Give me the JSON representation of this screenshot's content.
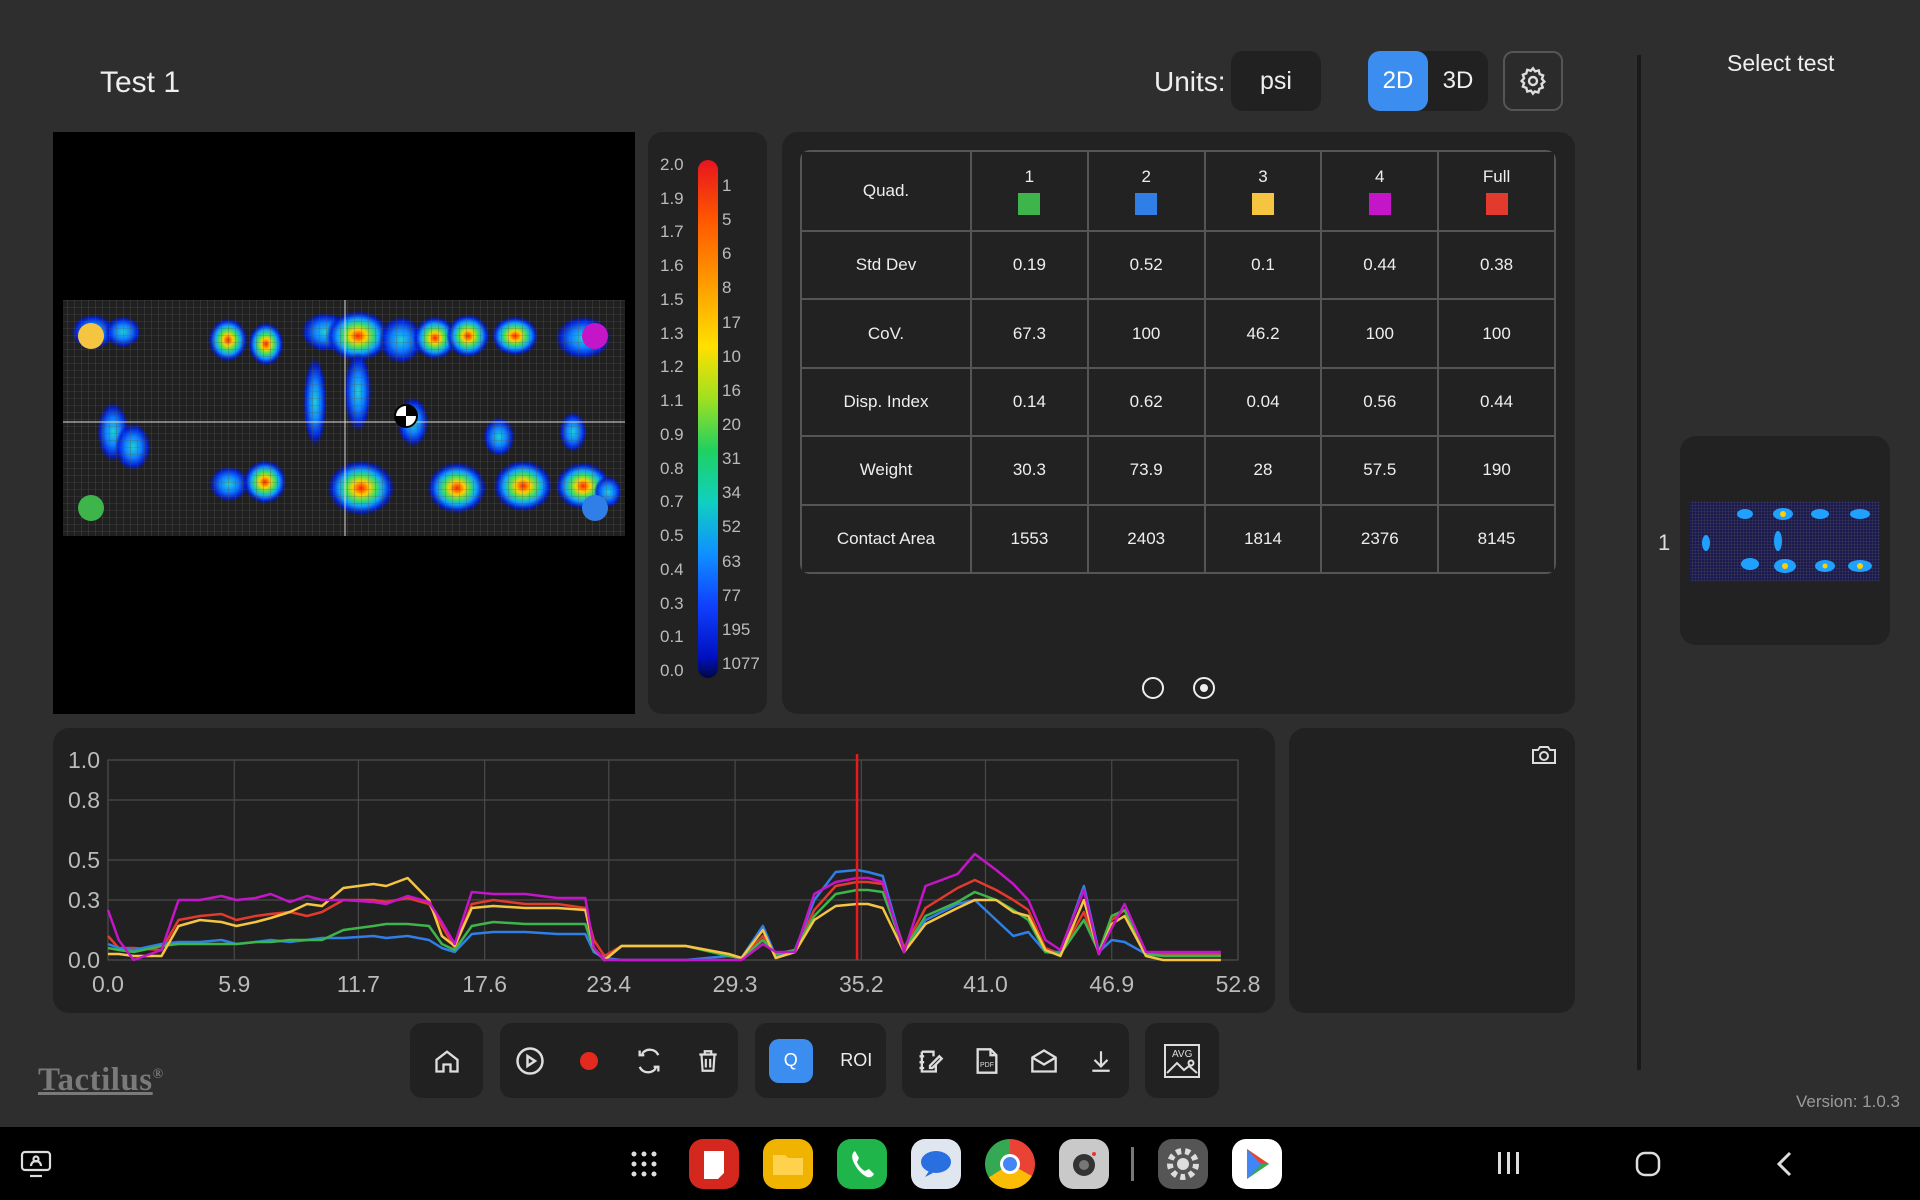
{
  "header": {
    "title": "Test 1",
    "units_label": "Units:",
    "units_value": "psi",
    "view_2d": "2D",
    "view_3d": "3D"
  },
  "scale": {
    "left_labels": [
      "2.0",
      "1.9",
      "1.7",
      "1.6",
      "1.5",
      "1.3",
      "1.2",
      "1.1",
      "0.9",
      "0.8",
      "0.7",
      "0.5",
      "0.4",
      "0.3",
      "0.1",
      "0.0"
    ],
    "right_labels": [
      "1",
      "5",
      "6",
      "8",
      "17",
      "10",
      "16",
      "20",
      "31",
      "34",
      "52",
      "63",
      "77",
      "195",
      "1077"
    ]
  },
  "table": {
    "corner": "Quad.",
    "columns": [
      {
        "label": "1",
        "color": "#3db54a"
      },
      {
        "label": "2",
        "color": "#2f7fe6"
      },
      {
        "label": "3",
        "color": "#f5c542"
      },
      {
        "label": "4",
        "color": "#c515c9"
      },
      {
        "label": "Full",
        "color": "#e23a2c"
      }
    ],
    "rows": [
      {
        "label": "Std Dev",
        "values": [
          "0.19",
          "0.52",
          "0.1",
          "0.44",
          "0.38"
        ]
      },
      {
        "label": "CoV.",
        "values": [
          "67.3",
          "100",
          "46.2",
          "100",
          "100"
        ]
      },
      {
        "label": "Disp. Index",
        "values": [
          "0.14",
          "0.62",
          "0.04",
          "0.56",
          "0.44"
        ]
      },
      {
        "label": "Weight",
        "values": [
          "30.3",
          "73.9",
          "28",
          "57.5",
          "190"
        ]
      },
      {
        "label": "Contact Area",
        "values": [
          "1553",
          "2403",
          "1814",
          "2376",
          "8145"
        ]
      }
    ]
  },
  "chart_data": {
    "type": "line",
    "x_ticks": [
      "0.0",
      "5.9",
      "11.7",
      "17.6",
      "23.4",
      "29.3",
      "35.2",
      "41.0",
      "46.9",
      "52.8"
    ],
    "y_ticks": [
      "0.0",
      "0.3",
      "0.5",
      "0.8",
      "1.0"
    ],
    "xlim": [
      0,
      52.8
    ],
    "ylim": [
      0,
      1.0
    ],
    "grid": true,
    "cursor_x": 35.0,
    "x": [
      0.0,
      0.5,
      1.2,
      2.5,
      3.3,
      4.3,
      5.3,
      6.0,
      6.9,
      7.6,
      8.5,
      9.3,
      10.0,
      11.0,
      12.4,
      13.0,
      14.0,
      15.0,
      15.6,
      16.2,
      17.0,
      18.0,
      19.5,
      21.0,
      22.3,
      22.7,
      23.2,
      24.0,
      27.0,
      29.0,
      29.6,
      30.6,
      31.2,
      32.1,
      33.0,
      34.0,
      35.0,
      35.5,
      36.2,
      37.2,
      38.2,
      39.7,
      40.5,
      41.5,
      42.3,
      43.0,
      43.8,
      44.5,
      45.6,
      46.3,
      46.9,
      47.5,
      48.5,
      49.3,
      52.0
    ],
    "series": [
      {
        "color": "#e23a2c",
        "values": [
          0.12,
          0.06,
          0.06,
          0.05,
          0.2,
          0.22,
          0.23,
          0.2,
          0.22,
          0.23,
          0.24,
          0.22,
          0.24,
          0.3,
          0.3,
          0.29,
          0.31,
          0.28,
          0.17,
          0.06,
          0.28,
          0.3,
          0.28,
          0.28,
          0.26,
          0.1,
          0.02,
          0.07,
          0.07,
          0.03,
          0.01,
          0.12,
          0.02,
          0.05,
          0.25,
          0.37,
          0.39,
          0.39,
          0.38,
          0.06,
          0.26,
          0.36,
          0.4,
          0.35,
          0.3,
          0.25,
          0.06,
          0.03,
          0.24,
          0.04,
          0.2,
          0.25,
          0.03,
          0.03,
          0.03
        ]
      },
      {
        "color": "#2f7fe6",
        "values": [
          0.08,
          0.06,
          0.05,
          0.08,
          0.09,
          0.09,
          0.1,
          0.08,
          0.09,
          0.1,
          0.09,
          0.1,
          0.11,
          0.11,
          0.12,
          0.11,
          0.12,
          0.1,
          0.06,
          0.04,
          0.13,
          0.14,
          0.14,
          0.13,
          0.13,
          0.04,
          0.01,
          0.0,
          0.0,
          0.02,
          0.01,
          0.17,
          0.02,
          0.05,
          0.3,
          0.44,
          0.45,
          0.44,
          0.42,
          0.04,
          0.2,
          0.28,
          0.3,
          0.2,
          0.12,
          0.14,
          0.04,
          0.04,
          0.37,
          0.04,
          0.1,
          0.09,
          0.03,
          0.02,
          0.02
        ]
      },
      {
        "color": "#3db54a",
        "values": [
          0.06,
          0.05,
          0.04,
          0.07,
          0.08,
          0.08,
          0.08,
          0.08,
          0.09,
          0.09,
          0.1,
          0.1,
          0.1,
          0.15,
          0.17,
          0.18,
          0.18,
          0.17,
          0.08,
          0.05,
          0.17,
          0.19,
          0.18,
          0.18,
          0.18,
          0.05,
          0.0,
          0.07,
          0.07,
          0.02,
          0.01,
          0.1,
          0.03,
          0.05,
          0.22,
          0.33,
          0.35,
          0.35,
          0.34,
          0.05,
          0.22,
          0.29,
          0.34,
          0.3,
          0.25,
          0.2,
          0.04,
          0.03,
          0.2,
          0.04,
          0.22,
          0.25,
          0.03,
          0.02,
          0.02
        ]
      },
      {
        "color": "#f5c542",
        "values": [
          0.03,
          0.03,
          0.02,
          0.02,
          0.17,
          0.2,
          0.19,
          0.17,
          0.19,
          0.21,
          0.24,
          0.28,
          0.27,
          0.36,
          0.38,
          0.37,
          0.41,
          0.3,
          0.12,
          0.07,
          0.26,
          0.27,
          0.26,
          0.26,
          0.25,
          0.06,
          0.0,
          0.07,
          0.07,
          0.03,
          0.01,
          0.15,
          0.01,
          0.04,
          0.2,
          0.27,
          0.28,
          0.28,
          0.26,
          0.04,
          0.18,
          0.26,
          0.3,
          0.3,
          0.24,
          0.22,
          0.05,
          0.02,
          0.3,
          0.03,
          0.18,
          0.22,
          0.02,
          0.0,
          0.0
        ]
      },
      {
        "color": "#c515c9",
        "values": [
          0.25,
          0.1,
          0.0,
          0.05,
          0.3,
          0.3,
          0.32,
          0.3,
          0.31,
          0.33,
          0.29,
          0.32,
          0.3,
          0.3,
          0.29,
          0.28,
          0.32,
          0.29,
          0.19,
          0.08,
          0.34,
          0.33,
          0.33,
          0.31,
          0.31,
          0.06,
          0.0,
          0.0,
          0.0,
          0.0,
          0.0,
          0.08,
          0.04,
          0.04,
          0.33,
          0.39,
          0.41,
          0.41,
          0.39,
          0.04,
          0.37,
          0.43,
          0.53,
          0.45,
          0.38,
          0.3,
          0.1,
          0.05,
          0.35,
          0.03,
          0.16,
          0.28,
          0.04,
          0.04,
          0.04
        ]
      }
    ]
  },
  "right_panel": {
    "title": "Select test",
    "index": "1"
  },
  "toolbar": {
    "q_label": "Q",
    "roi_label": "ROI",
    "avg_label": "AVG"
  },
  "brand": "Tactilus",
  "brand_mark": "®",
  "version": "Version: 1.0.3",
  "icons": {
    "settings": "gear-icon",
    "home": "home-icon",
    "play": "play-icon",
    "record": "record-icon",
    "refresh": "refresh-icon",
    "delete": "trash-icon",
    "edit": "edit-icon",
    "pdf": "pdf-icon",
    "email": "mail-icon",
    "download": "download-icon",
    "camera": "camera-icon"
  }
}
